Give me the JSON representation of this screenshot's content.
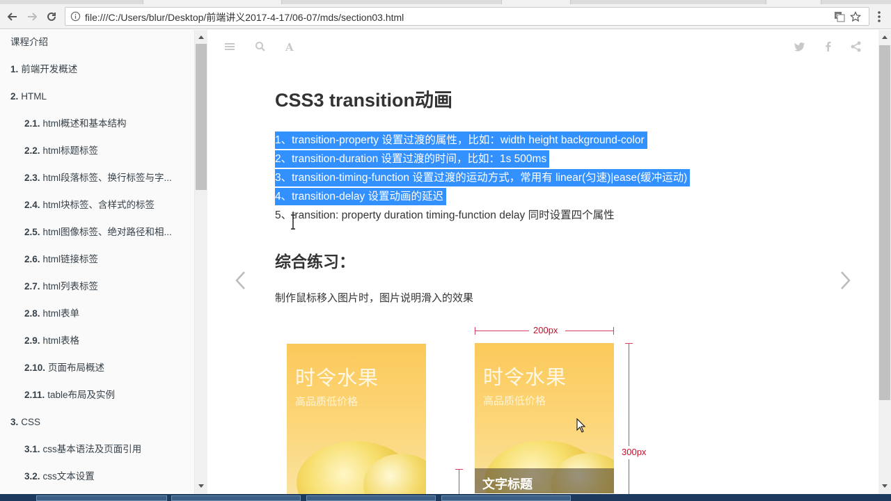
{
  "browser": {
    "url": "file:///C:/Users/blur/Desktop/前端讲义2017-4-17/06-07/mds/section03.html",
    "icons": [
      "back-icon",
      "forward-icon",
      "reload-icon",
      "info-icon",
      "translate-icon",
      "star-icon",
      "menu-icon"
    ]
  },
  "sidebar": {
    "items": [
      {
        "num": "",
        "label": "课程介绍",
        "level": 1
      },
      {
        "num": "1.",
        "label": "前端开发概述",
        "level": 1
      },
      {
        "num": "2.",
        "label": "HTML",
        "level": 1
      },
      {
        "num": "2.1.",
        "label": "html概述和基本结构",
        "level": 2
      },
      {
        "num": "2.2.",
        "label": "html标题标签",
        "level": 2
      },
      {
        "num": "2.3.",
        "label": "html段落标签、换行标签与字...",
        "level": 2
      },
      {
        "num": "2.4.",
        "label": "html块标签、含样式的标签",
        "level": 2
      },
      {
        "num": "2.5.",
        "label": "html图像标签、绝对路径和相...",
        "level": 2
      },
      {
        "num": "2.6.",
        "label": "html链接标签",
        "level": 2
      },
      {
        "num": "2.7.",
        "label": "html列表标签",
        "level": 2
      },
      {
        "num": "2.8.",
        "label": "html表单",
        "level": 2
      },
      {
        "num": "2.9.",
        "label": "html表格",
        "level": 2
      },
      {
        "num": "2.10.",
        "label": "页面布局概述",
        "level": 2
      },
      {
        "num": "2.11.",
        "label": "table布局及实例",
        "level": 2
      },
      {
        "num": "3.",
        "label": "CSS",
        "level": 1
      },
      {
        "num": "3.1.",
        "label": "css基本语法及页面引用",
        "level": 2
      },
      {
        "num": "3.2.",
        "label": "css文本设置",
        "level": 2
      }
    ]
  },
  "header_icons": [
    "hamburger-icon",
    "search-icon",
    "font-icon",
    "twitter-icon",
    "facebook-icon",
    "share-icon"
  ],
  "content": {
    "title": "CSS3 transition动画",
    "lines": [
      {
        "text": "1、transition-property 设置过渡的属性，比如：width height background-color",
        "selected": true
      },
      {
        "text": "2、transition-duration 设置过渡的时间，比如：1s 500ms",
        "selected": true
      },
      {
        "text": "3、transition-timing-function 设置过渡的运动方式，常用有 linear(匀速)|ease(缓冲运动)",
        "selected": true
      },
      {
        "text": "4、transition-delay 设置动画的延迟",
        "selected": true
      },
      {
        "text": "5、transition: property duration timing-function delay 同时设置四个属性",
        "selected": false
      }
    ],
    "section_title": "综合练习：",
    "paragraph": "制作鼠标移入图片时，图片说明滑入的效果"
  },
  "illustration": {
    "card_title": "时令水果",
    "card_subtitle": "高品质低价格",
    "caption": "文字标题",
    "width_label": "200px",
    "height_label": "300px"
  },
  "colors": {
    "selection": "#3390ff",
    "dimension": "#c0102a",
    "card_top": "#fbc95a"
  }
}
